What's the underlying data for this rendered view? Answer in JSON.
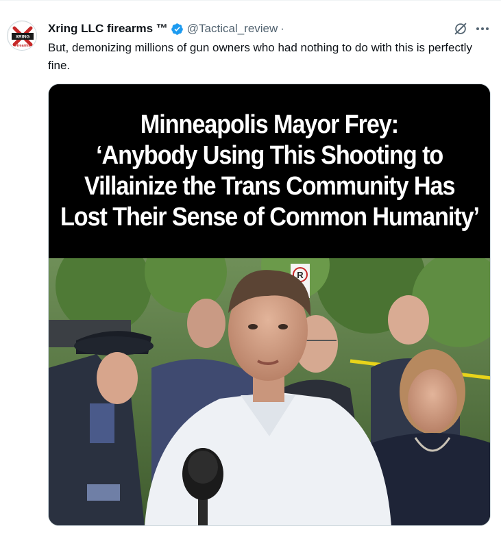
{
  "post": {
    "author_name": "Xring LLC firearms ™",
    "handle": "@Tactical_review",
    "separator": "·",
    "text": "But, demonizing millions of gun owners who had nothing to do with this is perfectly fine.",
    "verified": true
  },
  "avatar": {
    "logo_text_top": "XRING",
    "logo_text_bottom": "Firearms"
  },
  "media": {
    "headline_lines": [
      "Minneapolis Mayor Frey:",
      "‘Anybody Using This Shooting to",
      "Villainize the Trans Community Has",
      "Lost Their Sense of Common Humanity’"
    ],
    "sign_letter": "R"
  },
  "icons": {
    "verified": "verified-badge-icon",
    "grok": "grok-icon",
    "more": "more-options-icon"
  },
  "colors": {
    "verified_blue": "#1d9bf0",
    "handle_gray": "#536471",
    "text": "#0f1419"
  }
}
